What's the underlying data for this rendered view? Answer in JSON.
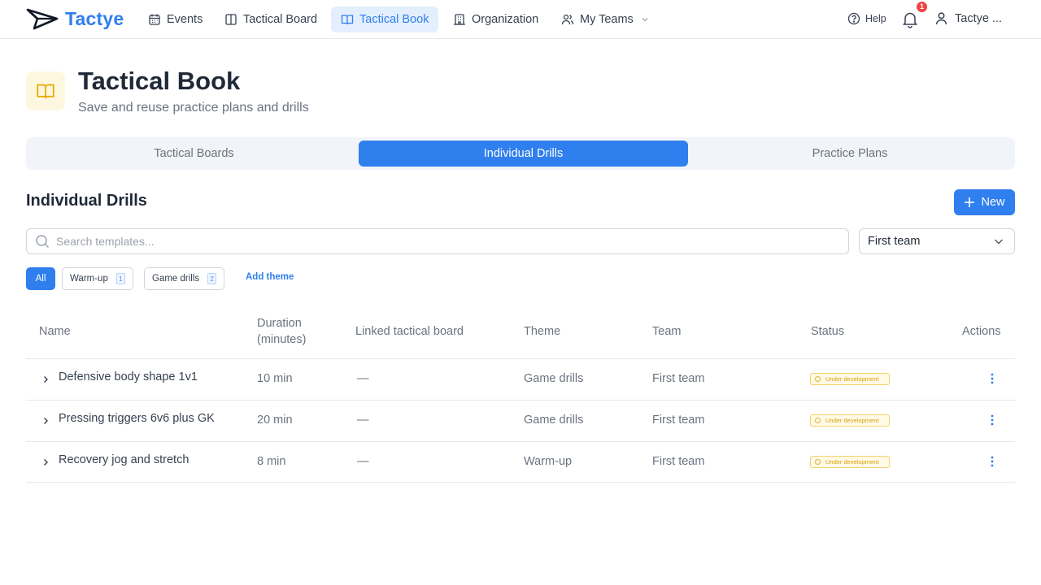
{
  "app": {
    "name": "Tactye"
  },
  "nav": {
    "items": [
      {
        "label": "Events",
        "icon": "calendar-icon"
      },
      {
        "label": "Tactical Board",
        "icon": "board-icon"
      },
      {
        "label": "Tactical Book",
        "icon": "book-icon",
        "active": true
      },
      {
        "label": "Organization",
        "icon": "building-icon"
      },
      {
        "label": "My Teams",
        "icon": "users-icon"
      }
    ],
    "help_label": "Help",
    "notification_count": "1",
    "user_name": "Tactye ..."
  },
  "header": {
    "title": "Tactical Book",
    "subtitle": "Save and reuse practice plans and drills"
  },
  "tabs": [
    "Tactical Boards",
    "Individual Drills",
    "Practice Plans"
  ],
  "active_tab": "Individual Drills",
  "section": {
    "title": "Individual Drills",
    "new_label": "New"
  },
  "search": {
    "placeholder": "Search templates...",
    "value": ""
  },
  "team_filter": {
    "selected": "First team"
  },
  "themes": {
    "all_label": "All",
    "chips": [
      {
        "label": "Warm-up",
        "count": "1"
      },
      {
        "label": "Game drills",
        "count": "2"
      }
    ],
    "add_label": "Add theme"
  },
  "table": {
    "headers": {
      "name": "Name",
      "duration_line1": "Duration",
      "duration_line2": "(minutes)",
      "linked": "Linked tactical board",
      "theme": "Theme",
      "team": "Team",
      "status": "Status",
      "actions": "Actions"
    },
    "rows": [
      {
        "name": "Defensive body shape 1v1",
        "duration": "10 min",
        "linked": "—",
        "theme": "Game drills",
        "team": "First team",
        "status": "Under development"
      },
      {
        "name": "Pressing triggers 6v6 plus GK",
        "duration": "20 min",
        "linked": "—",
        "theme": "Game drills",
        "team": "First team",
        "status": "Under development"
      },
      {
        "name": "Recovery jog and stretch",
        "duration": "8 min",
        "linked": "—",
        "theme": "Warm-up",
        "team": "First team",
        "status": "Under development"
      }
    ]
  },
  "colors": {
    "accent": "#2f7fee",
    "status_warning": "#d9a20f",
    "badge": "#ef4444"
  }
}
